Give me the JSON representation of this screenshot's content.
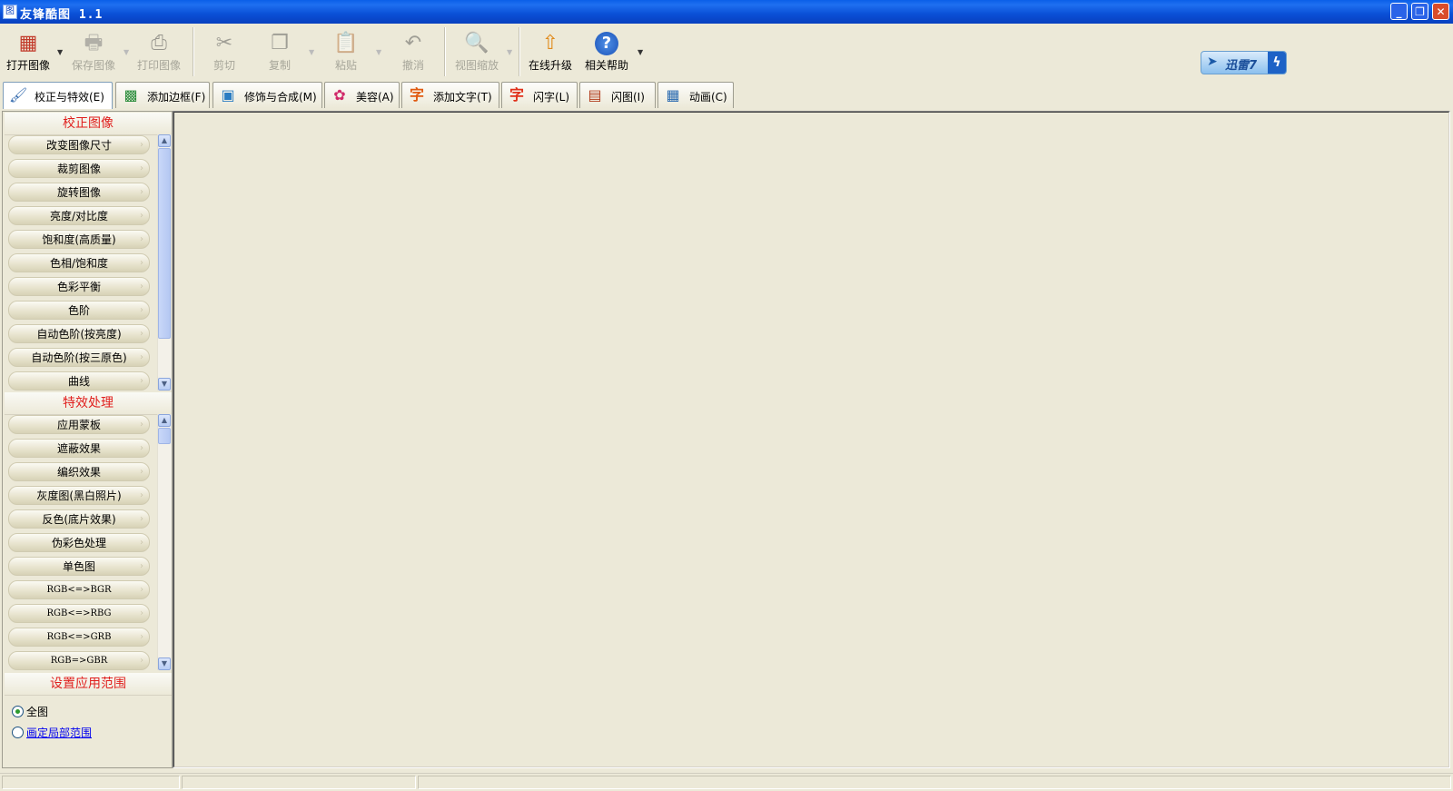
{
  "window": {
    "title": "友锋酷图  1.1",
    "app_icon": "app-icon",
    "controls": [
      "minimize",
      "maximize",
      "close"
    ]
  },
  "toolbar": {
    "buttons": [
      {
        "label": "打开图像",
        "icon": "open-image-icon",
        "enabled": true,
        "dropdown": true
      },
      {
        "label": "保存图像",
        "icon": "save-image-icon",
        "enabled": false,
        "dropdown": true
      },
      {
        "label": "打印图像",
        "icon": "printer-icon",
        "enabled": false
      },
      {
        "label": "剪切",
        "icon": "scissors-icon",
        "enabled": false
      },
      {
        "label": "复制",
        "icon": "copy-icon",
        "enabled": false,
        "dropdown": true
      },
      {
        "label": "粘贴",
        "icon": "paste-icon",
        "enabled": false,
        "dropdown": true
      },
      {
        "label": "撤消",
        "icon": "undo-icon",
        "enabled": false
      },
      {
        "label": "视图缩放",
        "icon": "zoom-icon",
        "enabled": false,
        "dropdown": true
      },
      {
        "label": "在线升级",
        "icon": "online-upgrade-icon",
        "enabled": true
      },
      {
        "label": "相关帮助",
        "icon": "help-icon",
        "enabled": true,
        "dropdown": true
      }
    ],
    "xunlei_label": "迅雷7"
  },
  "tabs": [
    {
      "label": "校正与特效(E)",
      "icon": "correct-effects-icon",
      "active": true
    },
    {
      "label": "添加边框(F)",
      "icon": "frame-icon",
      "active": false
    },
    {
      "label": "修饰与合成(M)",
      "icon": "decorate-icon",
      "active": false
    },
    {
      "label": "美容(A)",
      "icon": "beauty-icon",
      "active": false
    },
    {
      "label": "添加文字(T)",
      "icon": "text-icon",
      "active": false
    },
    {
      "label": "闪字(L)",
      "icon": "flash-text-icon",
      "active": false
    },
    {
      "label": "闪图(I)",
      "icon": "flash-image-icon",
      "active": false
    },
    {
      "label": "动画(C)",
      "icon": "animation-icon",
      "active": false
    }
  ],
  "left_panel": {
    "correct_section": {
      "title": "校正图像",
      "items": [
        "改变图像尺寸",
        "裁剪图像",
        "旋转图像",
        "亮度/对比度",
        "饱和度(高质量)",
        "色相/饱和度",
        "色彩平衡",
        "色阶",
        "自动色阶(按亮度)",
        "自动色阶(按三原色)",
        "曲线"
      ]
    },
    "effects_section": {
      "title": "特效处理",
      "items": [
        "应用蒙板",
        "遮蔽效果",
        "编织效果",
        "灰度图(黑白照片)",
        "反色(底片效果)",
        "伪彩色处理",
        "单色图",
        "RGB<=>BGR",
        "RGB<=>RBG",
        "RGB<=>GRB",
        "RGB=>GBR"
      ]
    },
    "range_section": {
      "title": "设置应用范围",
      "options": [
        {
          "label": "全图",
          "selected": true
        },
        {
          "label": "画定局部范围",
          "selected": false
        }
      ]
    }
  },
  "colors": {
    "title_bar": "#0a4fd6",
    "section_title": "#e0201e",
    "background": "#ece9d8",
    "link": "#0000ee"
  }
}
